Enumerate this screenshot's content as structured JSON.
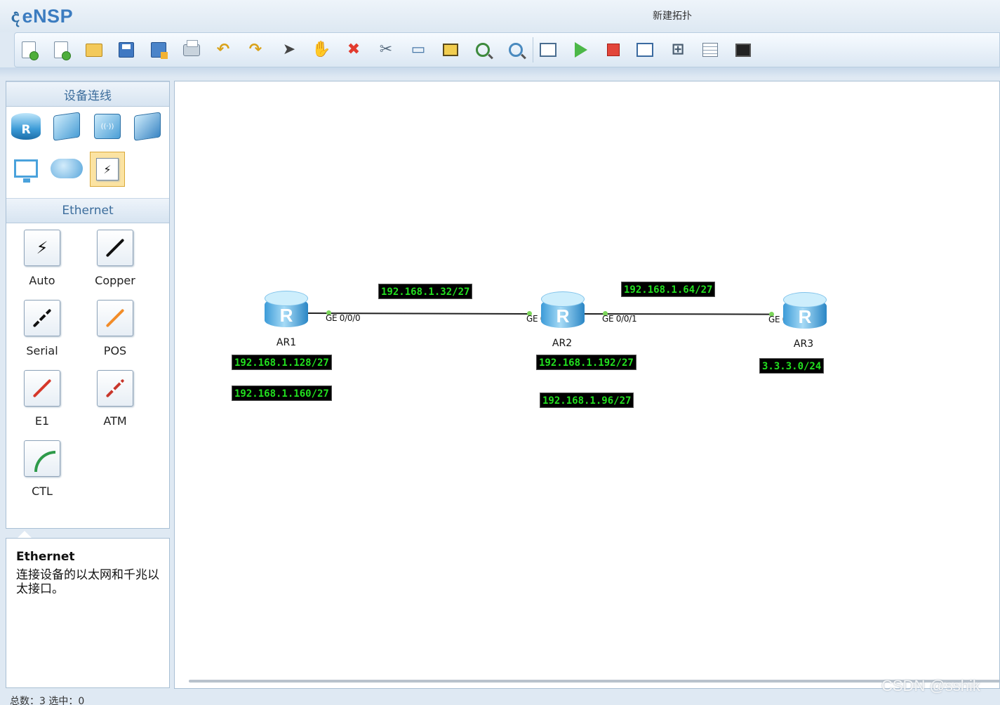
{
  "app": {
    "logo_mark": "ද",
    "logo_name": "eNSP",
    "window_title": "新建拓扑"
  },
  "toolbar": {
    "buttons": [
      {
        "name": "new-topology",
        "icon": "new-doc-icon"
      },
      {
        "name": "new-exam",
        "icon": "new-exam-icon"
      },
      {
        "name": "open",
        "icon": "folder-icon"
      },
      {
        "name": "save",
        "icon": "save-icon"
      },
      {
        "name": "save-as",
        "icon": "save-as-icon"
      },
      {
        "name": "print",
        "icon": "print-icon"
      },
      {
        "name": "undo",
        "icon": "undo-icon"
      },
      {
        "name": "redo",
        "icon": "redo-icon"
      },
      {
        "name": "select",
        "icon": "pointer-icon"
      },
      {
        "name": "pan",
        "icon": "hand-icon"
      },
      {
        "name": "delete",
        "icon": "delete-icon"
      },
      {
        "name": "delete-links",
        "icon": "delete-link-icon"
      },
      {
        "name": "add-text",
        "icon": "text-note-icon"
      },
      {
        "name": "add-shape",
        "icon": "rectangle-icon"
      },
      {
        "name": "zoom-in",
        "icon": "zoom-in-icon"
      },
      {
        "name": "zoom-out",
        "icon": "zoom-out-icon"
      },
      {
        "name": "fit-view",
        "icon": "fit-view-icon"
      },
      {
        "name": "start-all",
        "icon": "play-icon"
      },
      {
        "name": "stop-all",
        "icon": "stop-icon"
      },
      {
        "name": "capture",
        "icon": "capture-icon"
      },
      {
        "name": "topology",
        "icon": "topology-icon"
      },
      {
        "name": "grid",
        "icon": "grid-icon"
      },
      {
        "name": "console",
        "icon": "screen-icon"
      }
    ]
  },
  "palette": {
    "category_header": "设备连线",
    "devices": [
      {
        "name": "router",
        "icon": "router-icon",
        "glyph": "R"
      },
      {
        "name": "switch",
        "icon": "switch-icon",
        "glyph": ""
      },
      {
        "name": "wlan",
        "icon": "wireless-icon",
        "glyph": "((·))"
      },
      {
        "name": "firewall",
        "icon": "firewall-icon",
        "glyph": ""
      },
      {
        "name": "pc",
        "icon": "pc-icon",
        "glyph": ""
      },
      {
        "name": "cloud",
        "icon": "cloud-icon",
        "glyph": ""
      },
      {
        "name": "links",
        "icon": "lightning-icon",
        "glyph": "⚡"
      }
    ],
    "cable_header": "Ethernet",
    "cables": [
      {
        "label": "Auto",
        "color": "#111111",
        "icon": "auto-cable-icon"
      },
      {
        "label": "Copper",
        "color": "#111111",
        "icon": "copper-cable-icon"
      },
      {
        "label": "Serial",
        "color": "#111111",
        "icon": "serial-cable-icon"
      },
      {
        "label": "POS",
        "color": "#f28c28",
        "icon": "pos-cable-icon"
      },
      {
        "label": "E1",
        "color": "#d6382a",
        "icon": "e1-cable-icon"
      },
      {
        "label": "ATM",
        "color": "#c8372c",
        "icon": "atm-cable-icon"
      },
      {
        "label": "CTL",
        "color": "#2e9a4a",
        "icon": "ctl-cable-icon"
      }
    ]
  },
  "description": {
    "title": "Ethernet",
    "text": "连接设备的以太网和千兆以太接口。"
  },
  "topology": {
    "routers": [
      {
        "label": "AR1",
        "glyph": "R"
      },
      {
        "label": "AR2",
        "glyph": "R"
      },
      {
        "label": "AR3",
        "glyph": "R"
      }
    ],
    "ports": [
      {
        "label": "GE 0/0/0"
      },
      {
        "label": "GE 0/0/0"
      },
      {
        "label": "GE 0/0/1"
      },
      {
        "label": "GE 0/0/0"
      }
    ],
    "networks": [
      "192.168.1.32/27",
      "192.168.1.64/27",
      "192.168.1.128/27",
      "192.168.1.160/27",
      "192.168.1.192/27",
      "192.168.1.96/27",
      "3.3.3.0/24"
    ]
  },
  "statusbar": {
    "text": "总数：3 选中：0"
  },
  "watermark": "CSDN @sshik"
}
